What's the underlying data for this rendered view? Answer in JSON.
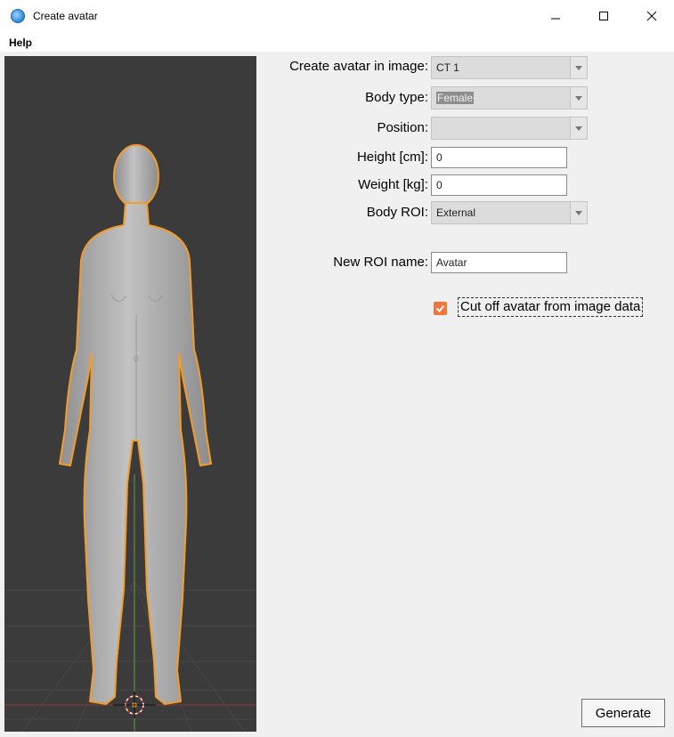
{
  "window": {
    "title": "Create avatar",
    "icon": "app-globe-icon"
  },
  "menu": {
    "items": [
      "Help"
    ]
  },
  "form": {
    "image_label": "Create avatar in image:",
    "image_value": "CT 1",
    "body_type_label": "Body type:",
    "body_type_value": "Female",
    "position_label": "Position:",
    "position_value": "",
    "height_label": "Height [cm]:",
    "height_value": "0",
    "weight_label": "Weight [kg]:",
    "weight_value": "0",
    "body_roi_label": "Body ROI:",
    "body_roi_value": "External",
    "roi_name_label": "New ROI name:",
    "roi_name_value": "Avatar",
    "cutoff_label": "Cut off avatar from image data",
    "cutoff_checked": true
  },
  "actions": {
    "generate_label": "Generate"
  },
  "colors": {
    "accent": "#f1763b",
    "viewport_bg": "#3b3b3b",
    "outline": "#f39c2c"
  }
}
